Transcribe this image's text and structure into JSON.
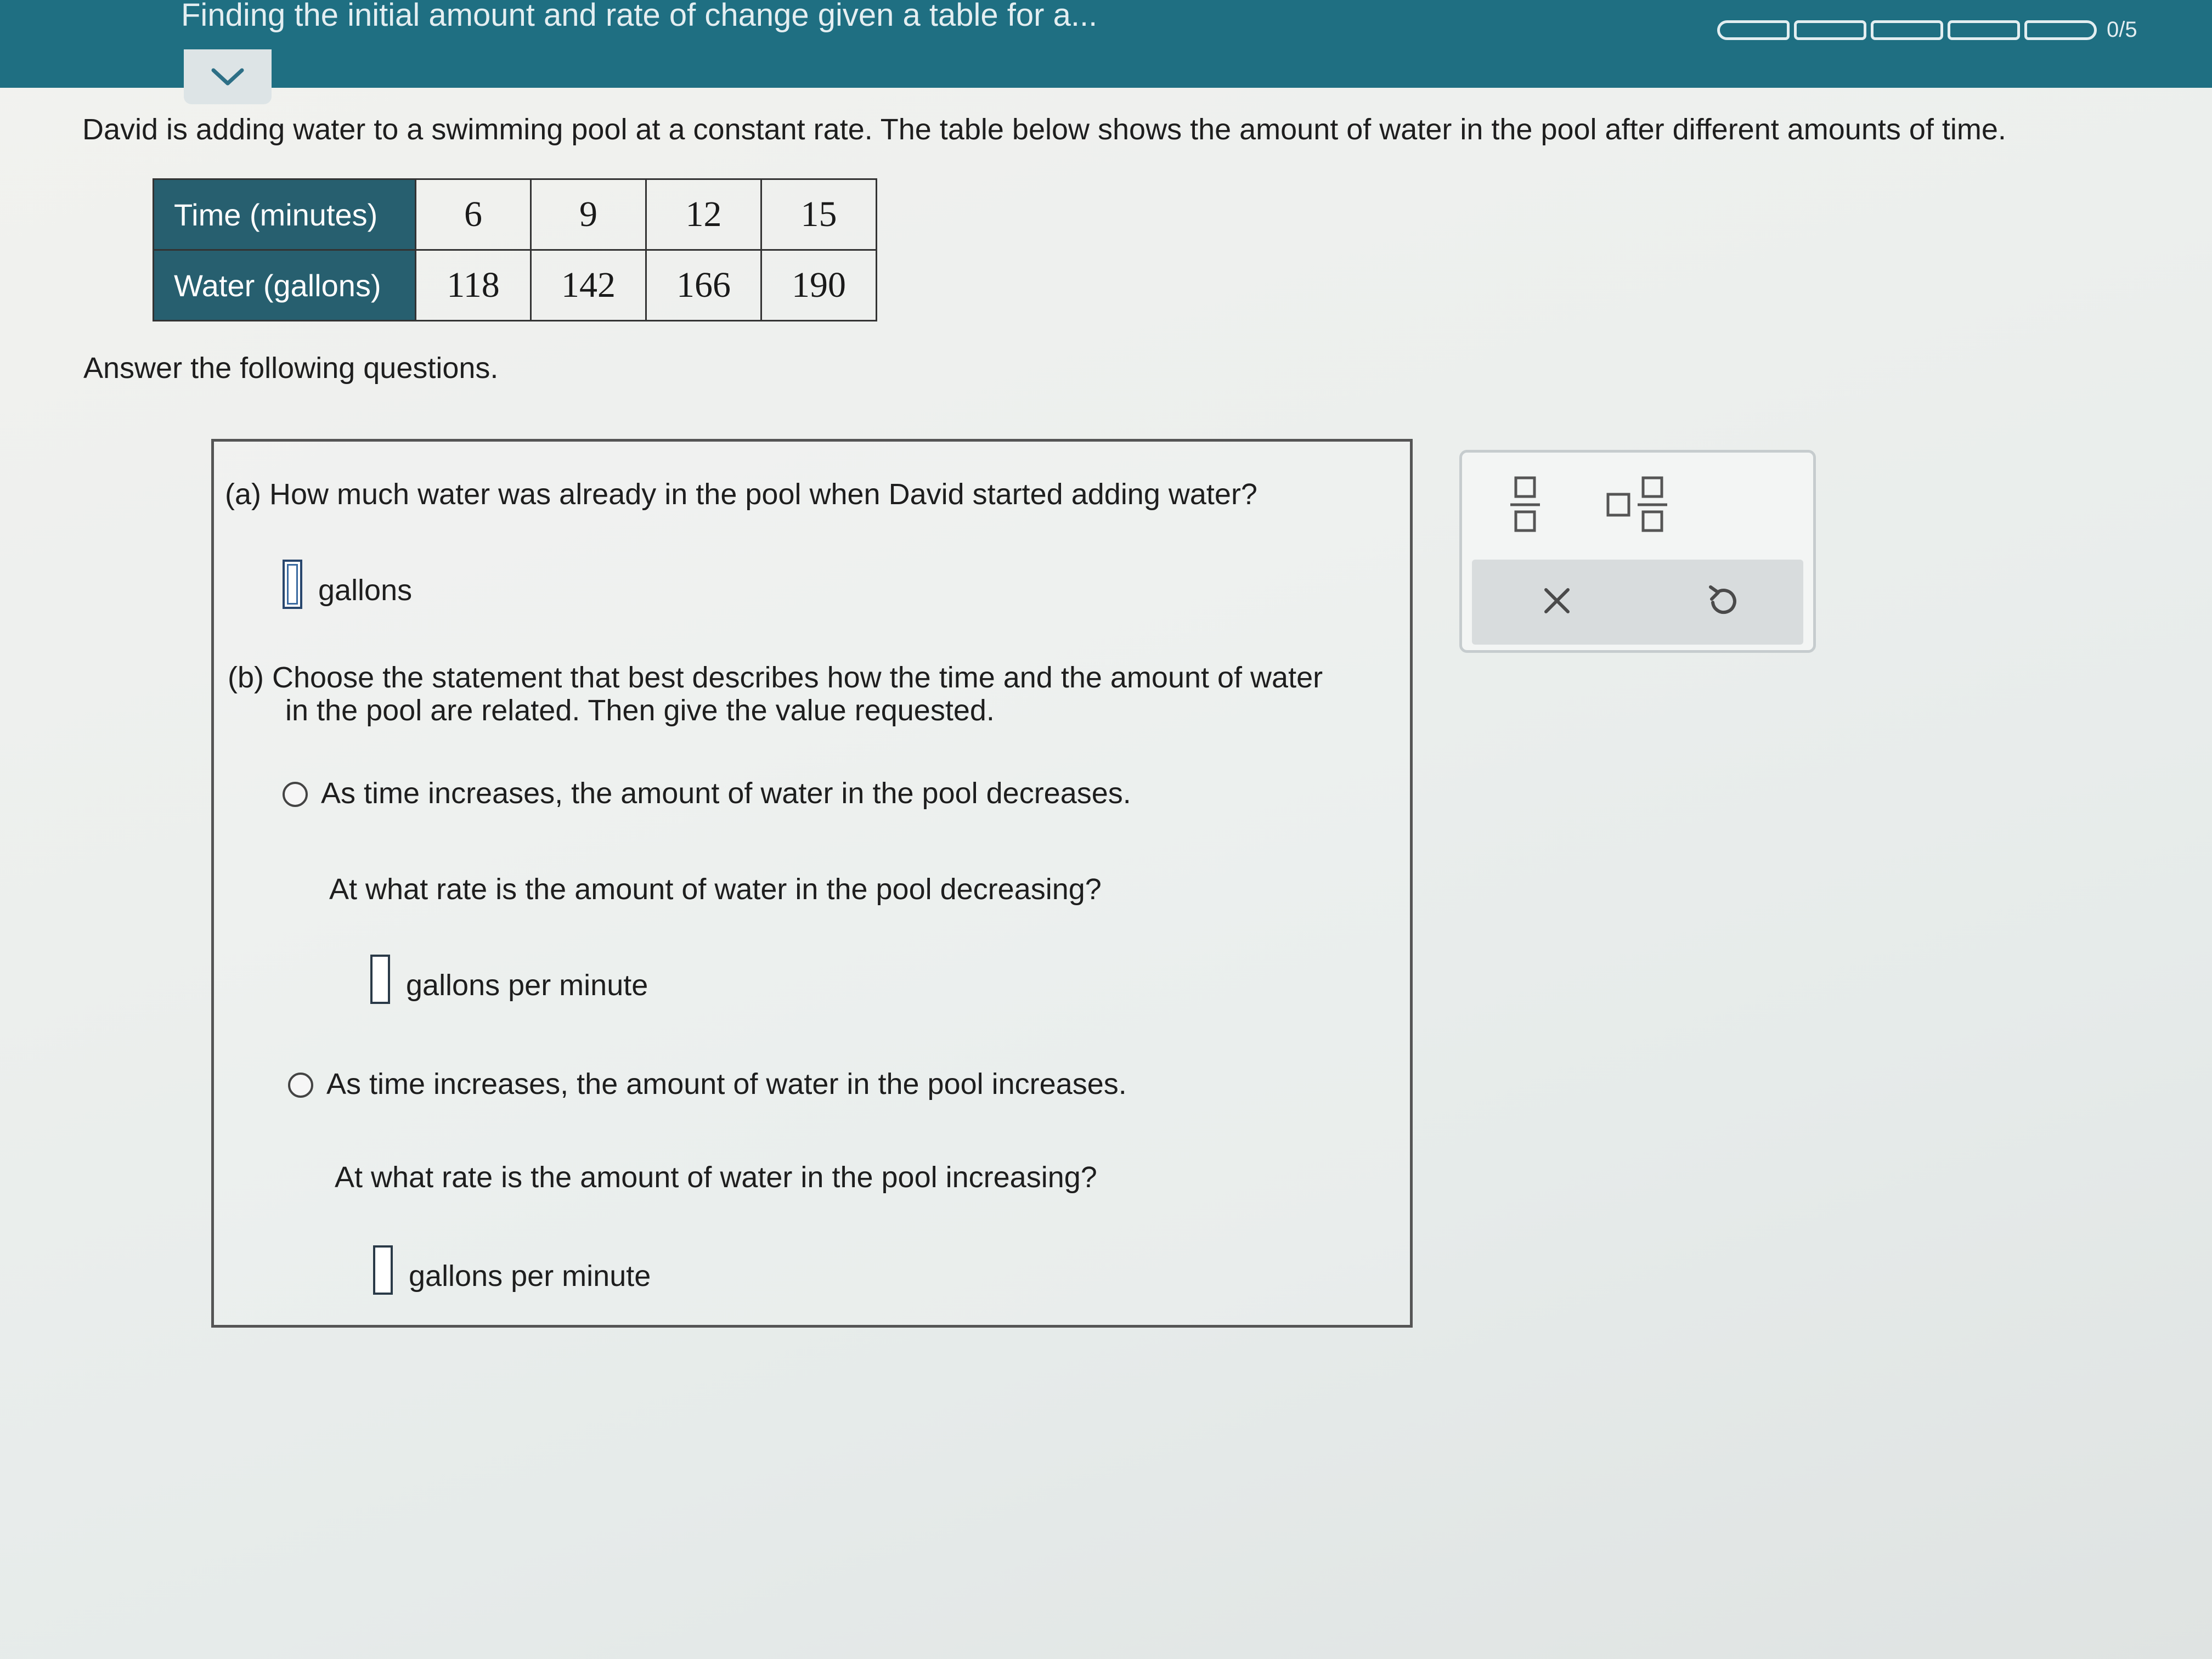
{
  "header": {
    "title": "Finding the initial amount and rate of change given a table for a...",
    "progress_text": "0/5",
    "progress_segments": 5,
    "progress_filled": 0,
    "bar_color": "#1f6f82"
  },
  "problem": {
    "prompt": "David is adding water to a swimming pool at a constant rate. The table below shows the amount of water in the pool after different amounts of time.",
    "table": {
      "row1_label": "Time (minutes)",
      "row1_values": [
        "6",
        "9",
        "12",
        "15"
      ],
      "row2_label": "Water (gallons)",
      "row2_values": [
        "118",
        "142",
        "166",
        "190"
      ],
      "header_color": "#275f6f"
    },
    "instruction": "Answer the following questions."
  },
  "part_a": {
    "question": "(a) How much water was already in the pool when David started adding water?",
    "unit": "gallons"
  },
  "part_b": {
    "question": "(b) Choose the statement that best describes how the time and the amount of water in the pool are related. Then give the value requested.",
    "option1": {
      "label": "As time increases, the amount of water in the pool decreases.",
      "followup": "At what rate is the amount of water in the pool decreasing?",
      "unit": "gallons per minute"
    },
    "option2": {
      "label": "As time increases, the amount of water in the pool increases.",
      "followup": "At what rate is the amount of water in the pool increasing?",
      "unit": "gallons per minute"
    }
  },
  "toolbar": {
    "icons": [
      "fraction-icon",
      "mixed-number-icon",
      "clear-icon",
      "undo-icon"
    ]
  }
}
